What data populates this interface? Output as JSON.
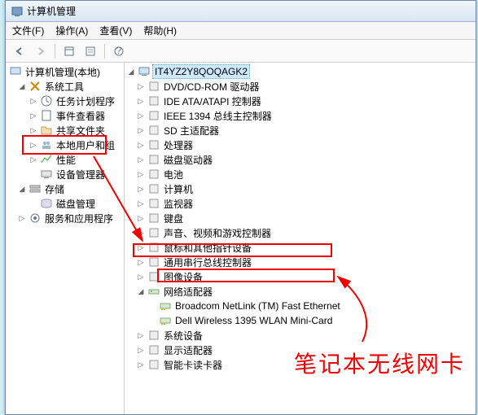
{
  "window": {
    "title": "计算机管理"
  },
  "menu": {
    "file": "文件(F)",
    "action": "操作(A)",
    "view": "查看(V)",
    "help": "帮助(H)"
  },
  "left": {
    "root": "计算机管理(本地)",
    "sysTools": "系统工具",
    "sysToolsItems": [
      "任务计划程序",
      "事件查看器",
      "共享文件夹",
      "本地用户和组",
      "性能",
      "设备管理器"
    ],
    "storage": "存储",
    "storageItems": [
      "磁盘管理"
    ],
    "services": "服务和应用程序"
  },
  "right": {
    "root": "IT4YZ2Y8QOQAGK2",
    "items": [
      "DVD/CD-ROM 驱动器",
      "IDE ATA/ATAPI 控制器",
      "IEEE 1394 总线主控制器",
      "SD 主适配器",
      "处理器",
      "磁盘驱动器",
      "电池",
      "计算机",
      "监视器",
      "键盘",
      "声音、视频和游戏控制器",
      "鼠标和其他指针设备",
      "通用串行总线控制器",
      "图像设备",
      "网络适配器",
      "系统设备",
      "显示适配器",
      "智能卡读卡器"
    ],
    "netChildren": [
      "Broadcom NetLink (TM) Fast Ethernet",
      "Dell Wireless 1395 WLAN Mini-Card"
    ]
  },
  "annotation": "笔记本无线网卡"
}
